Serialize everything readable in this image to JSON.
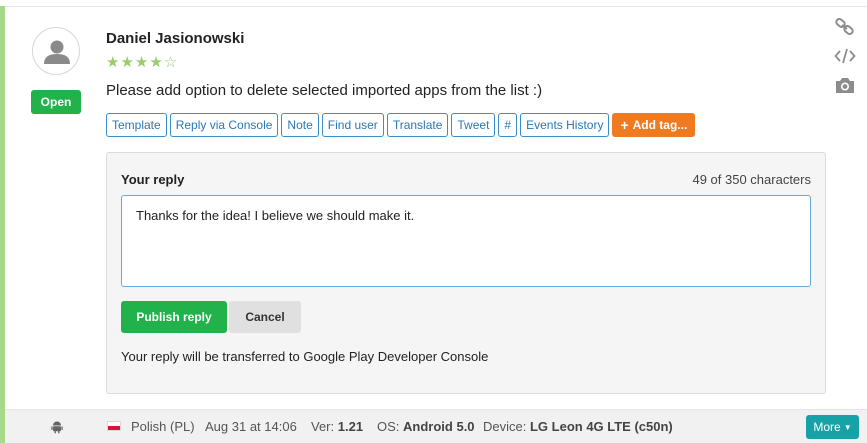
{
  "review": {
    "author": "Daniel Jasionowski",
    "rating": 4,
    "rating_max": 5,
    "status": "Open",
    "text": "Please add option to delete selected imported apps from the list :)"
  },
  "toolbar": {
    "buttons": [
      "Template",
      "Reply via Console",
      "Note",
      "Find user",
      "Translate",
      "Tweet",
      "#",
      "Events History"
    ],
    "add_tag_label": "Add tag...",
    "add_tag_icon": "plus-icon",
    "side_icons": [
      "link-icon",
      "code-icon",
      "camera-icon"
    ]
  },
  "reply": {
    "title": "Your reply",
    "char_count": "49 of 350 characters",
    "text": "Thanks for the idea! I believe we should make it.",
    "publish_label": "Publish reply",
    "cancel_label": "Cancel",
    "transfer_note": "Your reply will be transferred to Google Play Developer Console"
  },
  "footer": {
    "platform_icon": "android-icon",
    "language": "Polish (PL)",
    "date": "Aug 31 at 14:06",
    "version_label": "Ver:",
    "version": "1.21",
    "os_label": "OS:",
    "os": "Android 5.0",
    "device_label": "Device:",
    "device": "LG Leon 4G LTE (c50n)",
    "more_label": "More"
  },
  "colors": {
    "accent_green": "#22b24c",
    "link_blue": "#2a78b6",
    "tag_orange": "#f07a1f",
    "more_teal": "#17a2a8",
    "star_green": "#9acd6e"
  }
}
